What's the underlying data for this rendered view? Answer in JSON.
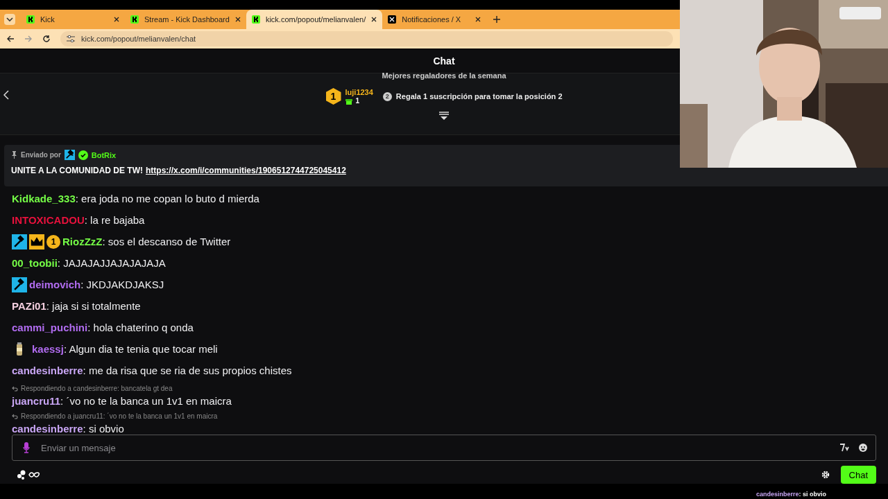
{
  "browser": {
    "tabs": [
      {
        "title": "Kick",
        "kind": "kick",
        "selected": false
      },
      {
        "title": "Stream - Kick Dashboard",
        "kind": "kick",
        "selected": false
      },
      {
        "title": "kick.com/popout/melianvalen/",
        "kind": "kick",
        "selected": true
      },
      {
        "title": "Notificaciones / X",
        "kind": "x",
        "selected": false
      }
    ],
    "address": "kick.com/popout/melianvalen/chat"
  },
  "chat": {
    "title": "Chat",
    "gifters": {
      "heading": "Mejores regaladores de la semana",
      "top": {
        "rank": "1",
        "name": "luji1234",
        "count": "1"
      },
      "next": {
        "rank": "2",
        "text": "Regala 1 suscripción para tomar la posición 2"
      }
    },
    "pinned": {
      "label": "Enviado por",
      "author": "BotRix",
      "text": "UNITE A LA COMUNIDAD DE TW!",
      "link": "https://x.com/i/communities/1906512744725045412"
    },
    "messages": [
      {
        "user": "Kidkade_333",
        "color": "#75fd46",
        "text": ": era joda no me copan lo buto d mierda"
      },
      {
        "user": "INTOXICADOU",
        "color": "#e9113c",
        "text": ": la re bajaba"
      },
      {
        "user": "RiozZzZ",
        "color": "#75fd46",
        "badges": [
          {
            "kind": "mod"
          },
          {
            "kind": "crown"
          },
          {
            "kind": "rank",
            "label": "1"
          }
        ],
        "text": ": sos el descanso de Twitter"
      },
      {
        "user": "00_toobii",
        "color": "#75fd46",
        "text": ": JAJAJAJJAJAJAJAJA"
      },
      {
        "user": "deimovich",
        "color": "#b16cf0",
        "badges": [
          {
            "kind": "mod"
          }
        ],
        "text": ": JKDJAKDJAKSJ"
      },
      {
        "user": "PAZi01",
        "color": "#f5d0e0",
        "text": ": jaja si si totalmente"
      },
      {
        "user": "cammi_puchini",
        "color": "#b16cf0",
        "text": ": hola chaterino q onda"
      },
      {
        "user": "kaessj",
        "color": "#b16cf0",
        "badges": [
          {
            "kind": "can"
          }
        ],
        "text": ": Algun dia te tenia que tocar meli"
      },
      {
        "user": "candesinberre",
        "color": "#c9a6f5",
        "text": ": me da risa que se ria de sus propios chistes"
      },
      {
        "user": "juancru11",
        "color": "#c9a6f5",
        "reply": "Respondiendo a candesinberre: bancatela gt dea",
        "text": ": ´vo no te la banca un 1v1 en maicra"
      },
      {
        "user": "candesinberre",
        "color": "#c9a6f5",
        "reply": "Respondiendo a juancru11: ´vo no te la banca un 1v1 en maicra",
        "text": ": si obvio"
      }
    ],
    "input": {
      "placeholder": "Enviar un mensaje"
    },
    "send": "Chat"
  },
  "overlay": {
    "user": "candesinberre",
    "text": ": si obvio"
  }
}
